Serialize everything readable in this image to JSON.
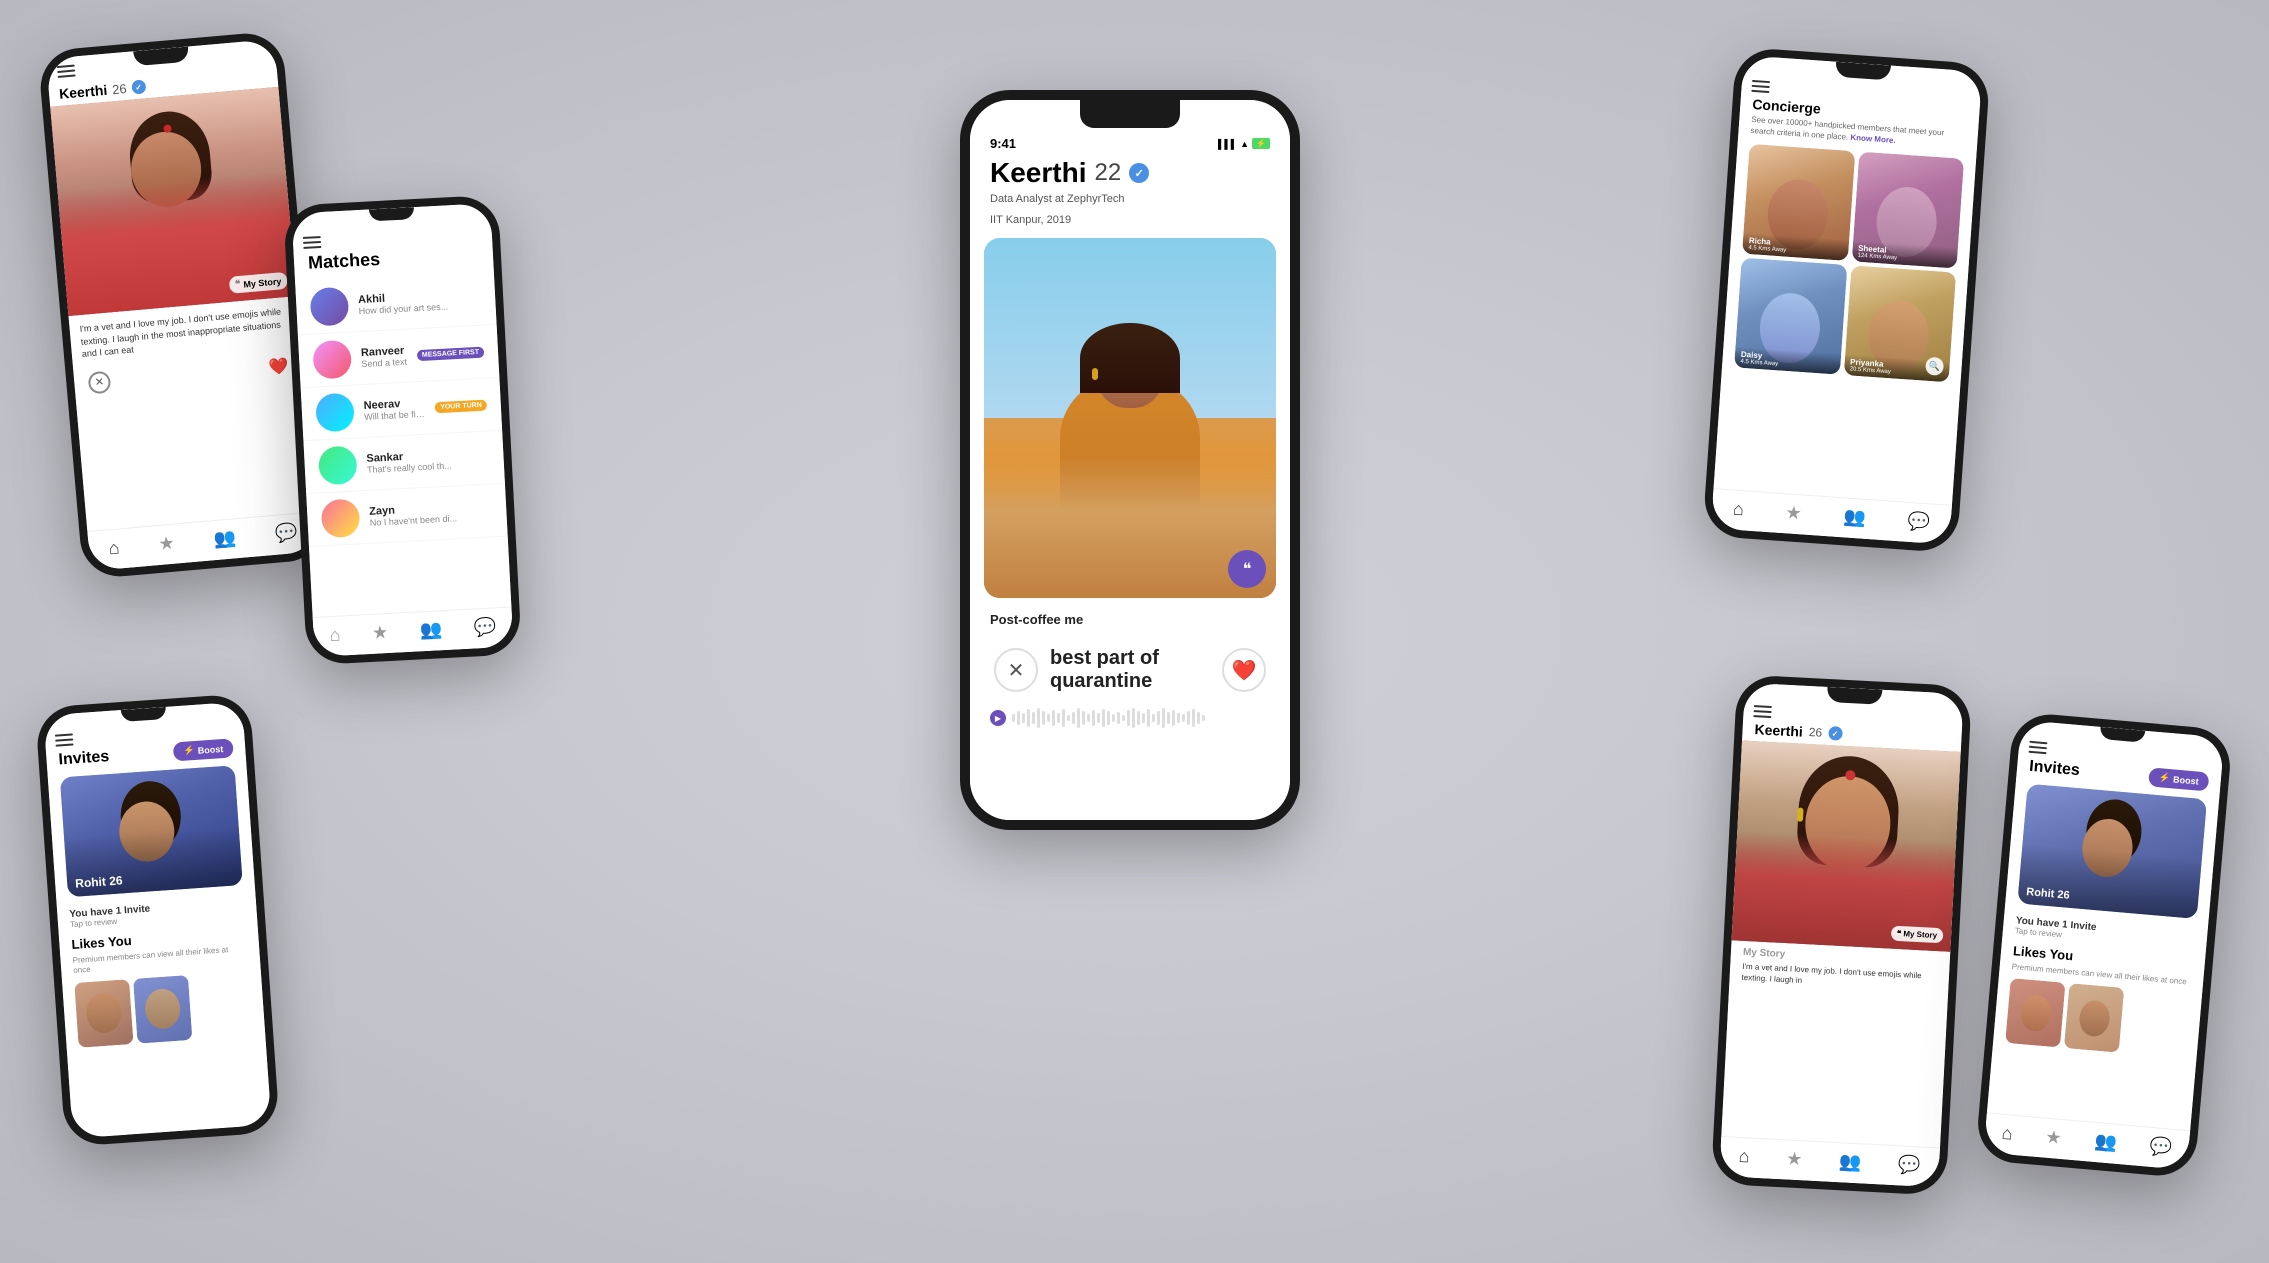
{
  "background": {
    "color": "#e2e2e8"
  },
  "phones": {
    "center": {
      "time": "9:41",
      "profile_name": "Keerthi",
      "profile_age": "22",
      "job": "Data Analyst at ZephyrTech",
      "education": "IIT Kanpur, 2019",
      "photo_caption": "Post-coffee me",
      "swipe_text": "best part of quarantine",
      "verified": "✓"
    },
    "top_left": {
      "profile_name": "Keerthi",
      "profile_age": "26",
      "verified": "✓",
      "story_label": "My Story",
      "story_text": "I'm a vet and I love my job. I don't use emojis while texting. I laugh in the most inappropriate situations and I can eat"
    },
    "matches": {
      "title": "Matches",
      "items": [
        {
          "name": "Akhil",
          "preview": "How did your art ses...",
          "badge": null
        },
        {
          "name": "Ranveer",
          "preview": "Send a text",
          "badge": "MESSAGE FIRST"
        },
        {
          "name": "Neerav",
          "preview": "Will that be fine?",
          "badge": "YOUR TURN"
        },
        {
          "name": "Sankar",
          "preview": "That's really cool th...",
          "badge": null
        },
        {
          "name": "Zayn",
          "preview": "No I have'nt been di...",
          "badge": null
        }
      ]
    },
    "concierge": {
      "title": "Concierge",
      "description": "See over 10000+ handpicked members that meet your search criteria in one place. Know More.",
      "members": [
        {
          "name": "Richa",
          "distance": "4.5 Kms Away"
        },
        {
          "name": "Sheetal",
          "distance": "124 Kms Away"
        },
        {
          "name": "Daisy",
          "distance": "4.5 Kms Away"
        },
        {
          "name": "Priyanka",
          "distance": "20.5 Kms Away"
        }
      ]
    },
    "invites_left": {
      "title": "Invites",
      "boost_label": "⚡ Boost",
      "invite_name": "Rohit",
      "invite_age": "26",
      "invite_count": "You have 1 Invite",
      "invite_tap": "Tap to review",
      "likes_title": "Likes You",
      "likes_desc": "Premium members can view all their likes at once"
    },
    "invites_right": {
      "title": "Invites",
      "boost_label": "⚡ Boost",
      "invite_name": "Rohit",
      "invite_age": "26",
      "invite_count": "You have 1 Invite",
      "invite_tap": "Tap to review",
      "likes_title": "Likes You",
      "likes_desc": "Premium members can view all their likes at once"
    },
    "keerthi_br": {
      "profile_name": "Keerthi",
      "profile_age": "26",
      "verified": "✓",
      "story_label": "My Story",
      "story_text": "I'm a vet and I love my job. I don't use emojis while texting. I laugh in"
    }
  },
  "nav": {
    "home_icon": "⌂",
    "star_icon": "★",
    "match_icon": "👥",
    "chat_icon": "💬"
  }
}
